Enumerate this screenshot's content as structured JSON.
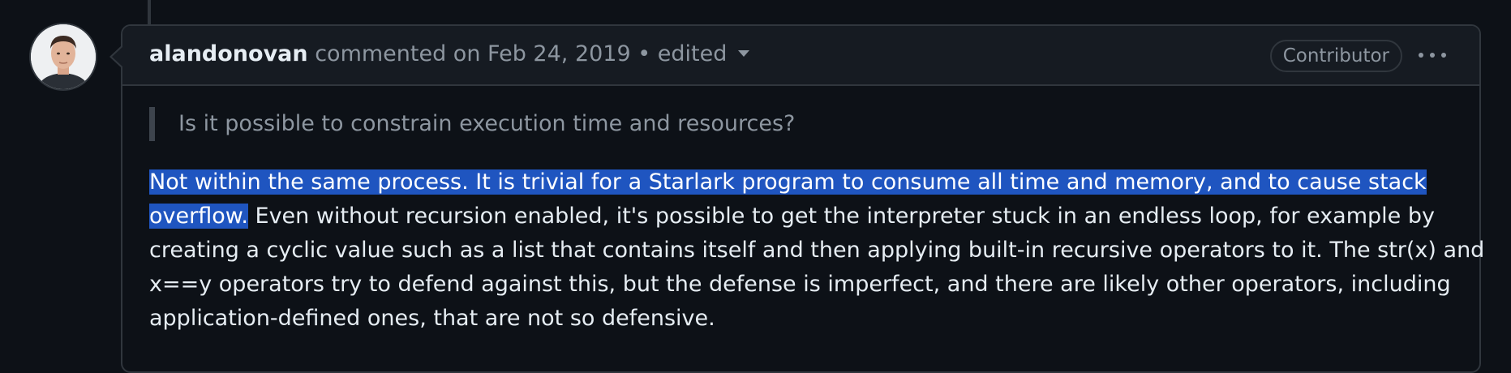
{
  "comment": {
    "author": "alandonovan",
    "action": "commented on",
    "date": "Feb 24, 2019",
    "separator": "•",
    "edited_label": "edited",
    "role_badge": "Contributor",
    "quote": "Is it possible to constrain execution time and resources?",
    "body": {
      "line1_selected": "Not within the same process. It is trivial for a Starlark program to consume all time and memory, and to cause stack",
      "line2_selected": "overflow.",
      "line2_rest": " Even without recursion enabled, it's possible to get the interpreter stuck in an endless loop, for example by",
      "line3": "creating a cyclic value such as a list that contains itself and then applying built-in recursive operators to it. The str(x) and",
      "line4": "x==y operators try to defend against this, but the defense is imperfect, and there are likely other operators, including",
      "line5": "application-defined ones, that are not so defensive."
    }
  },
  "icons": {
    "avatar": "user-avatar",
    "more": "kebab-horizontal-icon",
    "caret": "triangle-down-icon"
  },
  "colors": {
    "background": "#0d1117",
    "header_background": "#161b22",
    "border": "#30363d",
    "muted_text": "#8d96a0",
    "selection": "#1f55c0"
  }
}
